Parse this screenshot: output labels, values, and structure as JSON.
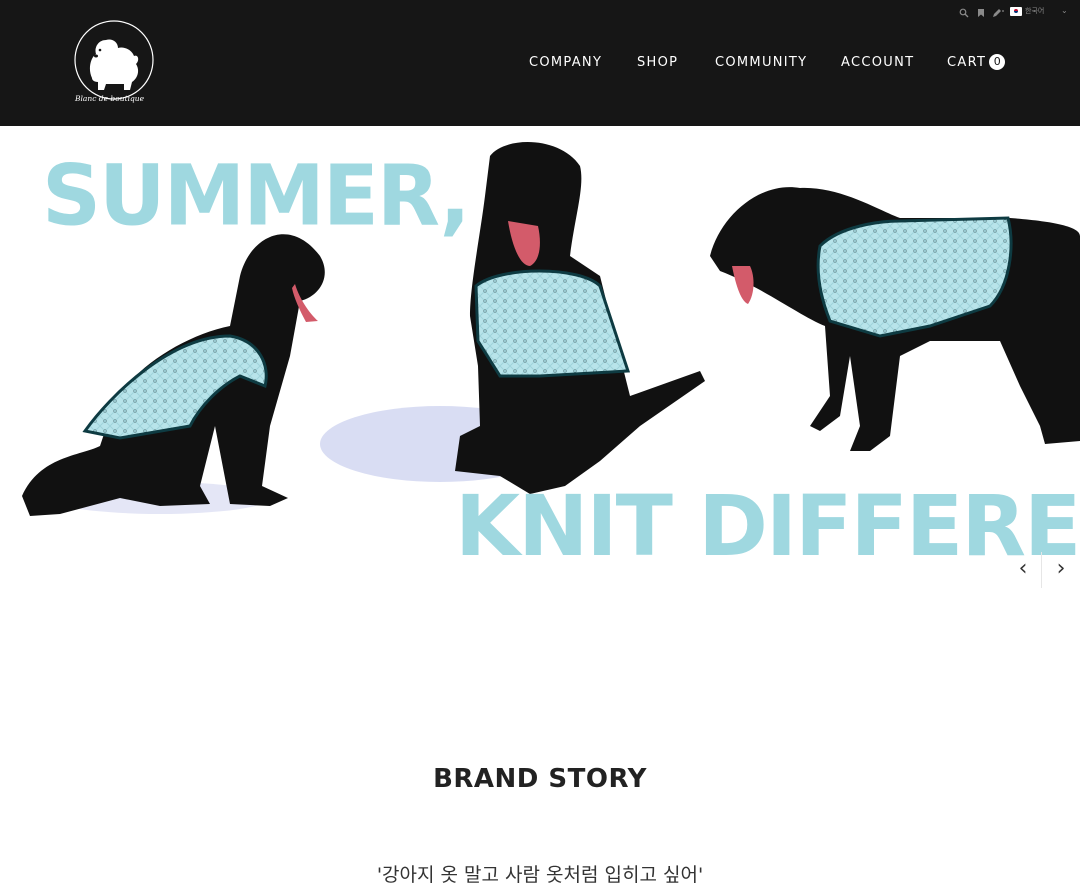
{
  "header": {
    "logo": {
      "icon": "maltese-dog-icon",
      "wordmark": "Blanc de boutique"
    },
    "nav": [
      {
        "label": "COMPANY"
      },
      {
        "label": "SHOP"
      },
      {
        "label": "COMMUNITY"
      },
      {
        "label": "ACCOUNT"
      },
      {
        "label": "CART",
        "count": "0"
      }
    ],
    "utility": {
      "icons": [
        "search-icon",
        "bookmark-icon",
        "pencil-icon"
      ],
      "language": {
        "label": "한국어",
        "flag": "korea-flag-icon"
      }
    }
  },
  "hero": {
    "headline_top": "SUMMER,",
    "headline_bottom": "KNIT DIFFERENT",
    "prev_arrow": "‹",
    "next_arrow": "›",
    "colors": {
      "headline": "#9fd8e0",
      "knit": "#a9dfe6",
      "dog": "#111111"
    }
  },
  "story": {
    "title": "BRAND STORY",
    "quote": "'강아지 옷 말고 사람 옷처럼 입히고 싶어'"
  },
  "colors": {
    "header_bg": "#161616",
    "nav_text": "#ffffff"
  }
}
